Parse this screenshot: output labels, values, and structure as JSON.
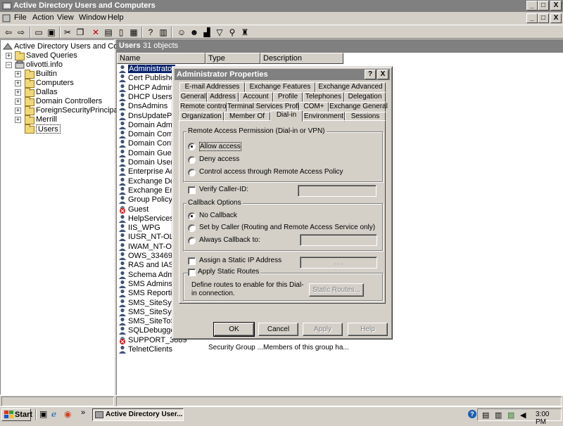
{
  "window": {
    "title": "Active Directory Users and Computers",
    "caption_buttons": [
      "_",
      "□",
      "X"
    ]
  },
  "menu": {
    "items": [
      {
        "label": "File"
      },
      {
        "label": "Action"
      },
      {
        "label": "View"
      },
      {
        "label": "Window"
      },
      {
        "label": "Help"
      }
    ],
    "mdi_buttons": [
      "_",
      "□",
      "X"
    ]
  },
  "toolbar": {
    "icons": [
      "back-icon",
      "forward-icon",
      "up-icon",
      "show-tree-icon",
      "cut-icon",
      "copy-icon",
      "delete-icon",
      "properties-icon",
      "refresh-icon",
      "export-icon",
      "help-icon",
      "console-icon",
      "new-user-icon",
      "new-group-icon",
      "new-ou-icon",
      "filter-icon",
      "find-icon",
      "add-to-group-icon"
    ]
  },
  "tree": {
    "root": "Active Directory Users and Computer",
    "items": [
      {
        "label": "Saved Queries"
      },
      {
        "label": "olivotti.info"
      },
      {
        "label": "Builtin"
      },
      {
        "label": "Computers"
      },
      {
        "label": "Dallas"
      },
      {
        "label": "Domain Controllers"
      },
      {
        "label": "ForeignSecurityPrincipals"
      },
      {
        "label": "Merrill"
      },
      {
        "label": "Users"
      }
    ]
  },
  "list": {
    "title": "Users",
    "count": "31 objects",
    "columns": [
      "Name",
      "Type",
      "Description"
    ],
    "rows": [
      "Administrator",
      "Cert Publishers",
      "DHCP Administra",
      "DHCP Users",
      "DnsAdmins",
      "DnsUpdateProxy",
      "Domain Admins",
      "Domain Compute",
      "Domain Controlle",
      "Domain Guests",
      "Domain Users",
      "Enterprise Admir",
      "Exchange Domai",
      "Exchange Enterp",
      "Group Policy Cre",
      "Guest",
      "HelpServicesGro",
      "IIS_WPG",
      "IUSR_NT-OLIVO",
      "IWAM_NT-OLIVO",
      "OWS_33469592",
      "RAS and IAS Ser",
      "Schema Admins",
      "SMS Admins",
      "SMS Reporting U",
      "SMS_SiteSystem",
      "SMS_SiteSystem",
      "SMS_SiteToSiteC",
      "SQLDebugger",
      "SUPPORT_3889",
      "TelnetClients"
    ],
    "last_row_type": "Security Group ...",
    "last_row_description": "Members of this group ha..."
  },
  "dialog": {
    "title": "Administrator Properties",
    "title_buttons": [
      "?",
      "X"
    ],
    "tabs_row1": [
      "E-mail Addresses",
      "Exchange Features",
      "Exchange Advanced"
    ],
    "tabs_row2": [
      "General",
      "Address",
      "Account",
      "Profile",
      "Telephones",
      "Delegation"
    ],
    "tabs_row3": [
      "Remote control",
      "Terminal Services Profile",
      "COM+",
      "Exchange General"
    ],
    "tabs_row4": [
      "Organization",
      "Member Of",
      "Dial-in",
      "Environment",
      "Sessions"
    ],
    "remote_access": {
      "group_label": "Remote Access Permission (Dial-in or VPN)",
      "allow": "Allow access",
      "deny": "Deny access",
      "control": "Control access through Remote Access Policy"
    },
    "verify_caller_id": "Verify Caller-ID:",
    "callback": {
      "group_label": "Callback Options",
      "no_callback": "No Callback",
      "set_by_caller": "Set by Caller (Routing and Remote Access Service only)",
      "always": "Always Callback to:"
    },
    "static_ip": "Assign a Static IP Address",
    "ip_placeholder": ".   .   .",
    "static_routes": {
      "label": "Apply Static Routes",
      "description": "Define routes to enable for this Dial-in connection.",
      "button": "Static Routes..."
    },
    "buttons": {
      "ok": "OK",
      "cancel": "Cancel",
      "apply": "Apply",
      "help": "Help"
    }
  },
  "taskbar": {
    "start": "Start",
    "task": "Active Directory User...",
    "clock": "3:00 PM",
    "tray_icons": [
      "help-icon",
      "network-icon",
      "printer-icon",
      "security-icon",
      "speaker-icon"
    ]
  }
}
